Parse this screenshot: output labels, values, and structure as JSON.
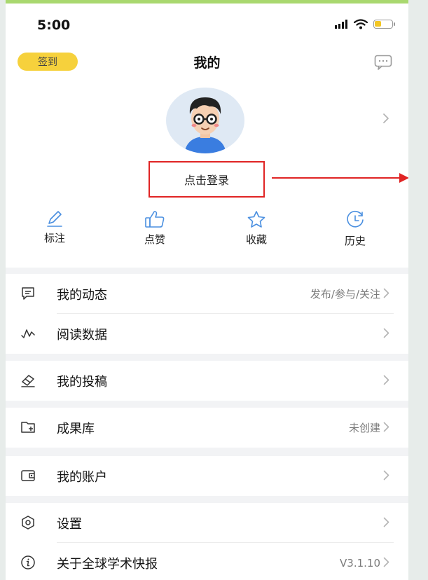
{
  "status_bar": {
    "time": "5:00"
  },
  "header": {
    "checkin_label": "签到",
    "title": "我的",
    "message_icon": "chat-bubble-icon"
  },
  "profile": {
    "login_label": "点击登录",
    "avatar_icon": "cartoon-avatar-icon"
  },
  "annotation": {
    "color": "#e02424"
  },
  "quick_actions": [
    {
      "label": "标注",
      "icon": "pencil-icon"
    },
    {
      "label": "点赞",
      "icon": "thumbs-up-icon"
    },
    {
      "label": "收藏",
      "icon": "star-icon"
    },
    {
      "label": "历史",
      "icon": "history-clock-icon"
    }
  ],
  "menu": {
    "my_activity": {
      "label": "我的动态",
      "right": "发布/参与/关注",
      "icon": "comment-icon"
    },
    "reading_data": {
      "label": "阅读数据",
      "right": "",
      "icon": "line-graph-icon"
    },
    "my_submissions": {
      "label": "我的投稿",
      "right": "",
      "icon": "eraser-send-icon"
    },
    "results_library": {
      "label": "成果库",
      "right": "未创建",
      "icon": "folder-add-icon"
    },
    "my_account": {
      "label": "我的账户",
      "right": "",
      "icon": "wallet-icon"
    },
    "settings": {
      "label": "设置",
      "right": "",
      "icon": "hexagon-settings-icon"
    },
    "about": {
      "label": "关于全球学术快报",
      "right": "V3.1.10",
      "icon": "info-icon"
    }
  },
  "colors": {
    "accent_yellow": "#f6d13c",
    "icon_blue": "#4a8fe0",
    "text_dark": "#111111",
    "text_gray": "#7a7a7a"
  }
}
